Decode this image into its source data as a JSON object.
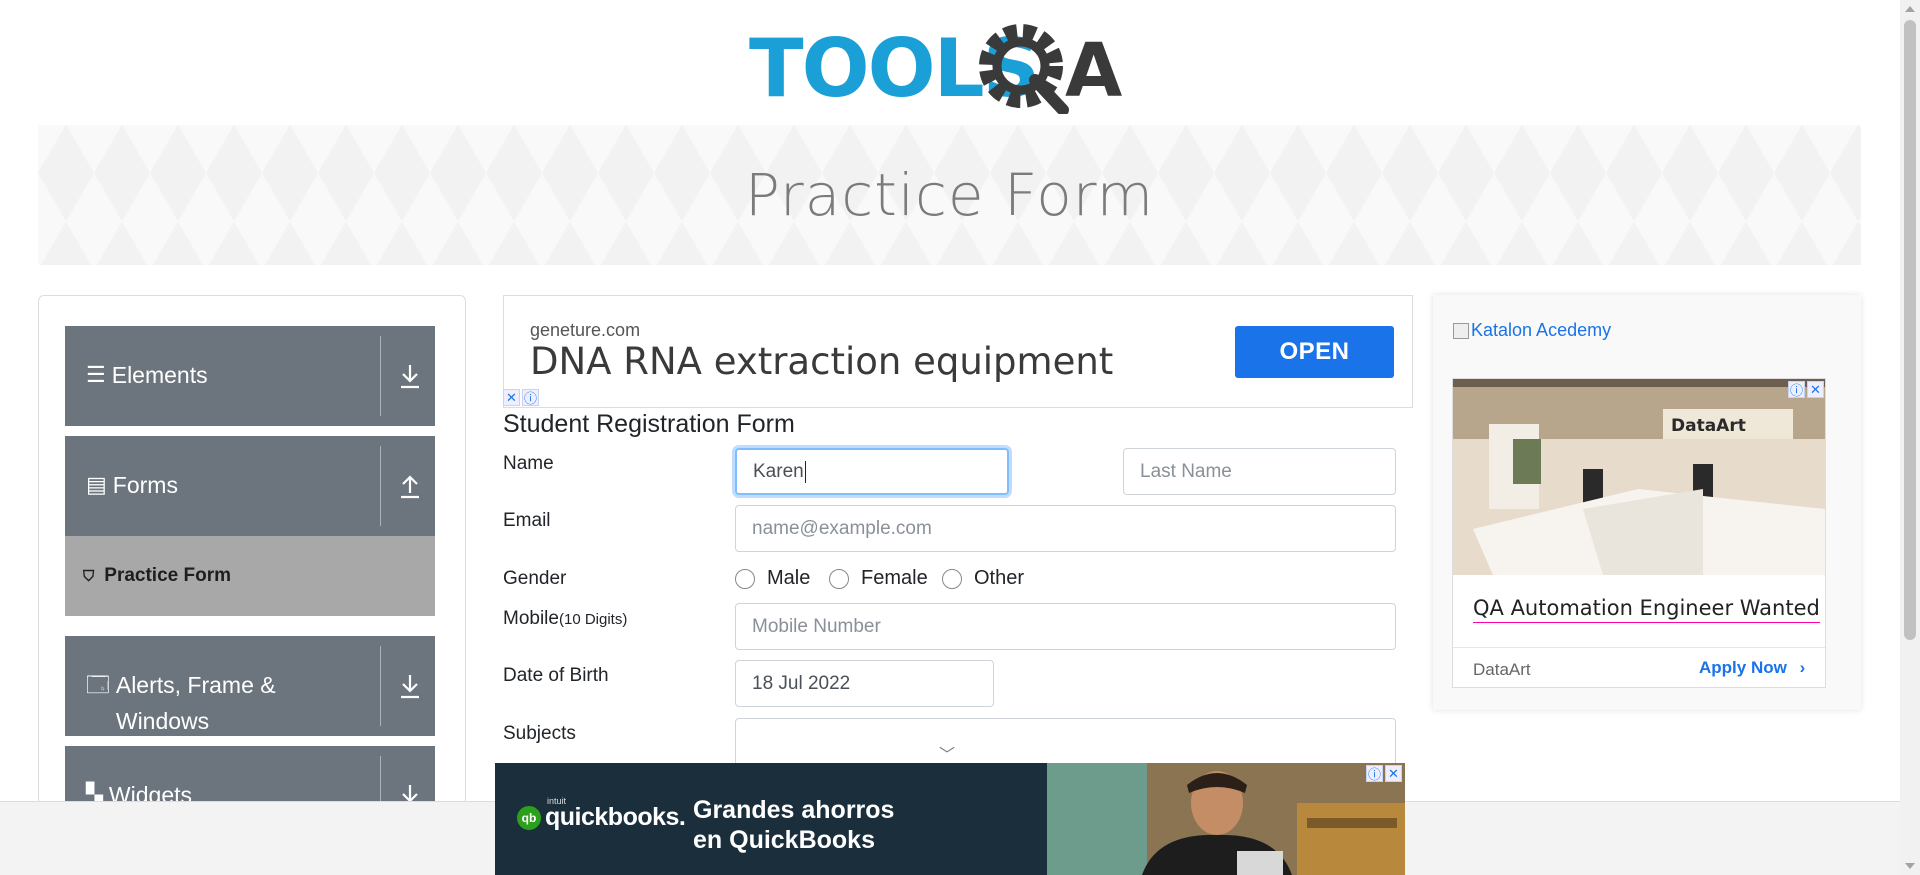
{
  "logo": {
    "text_left": "TOOLS",
    "text_right": "QA"
  },
  "banner": {
    "title": "Practice Form"
  },
  "sidebar": {
    "groups": [
      {
        "label": "Elements",
        "icon": "hamburger-icon",
        "toggle": "download-arrow-icon"
      },
      {
        "label": "Forms",
        "icon": "document-icon",
        "toggle": "upload-arrow-icon"
      },
      {
        "label": "Alerts, Frame &",
        "label2": "Windows",
        "icon": "window-icon",
        "toggle": "download-arrow-icon"
      },
      {
        "label": "Widgets",
        "icon": "widgets-icon",
        "toggle": "download-arrow-icon"
      }
    ],
    "active_item": {
      "label": "Practice Form",
      "icon": "html5-icon"
    }
  },
  "ad_top": {
    "domain": "geneture.com",
    "headline": "DNA RNA extraction equipment",
    "cta": "OPEN"
  },
  "form": {
    "title": "Student Registration Form",
    "name_label": "Name",
    "first_name_value": "Karen",
    "last_name_placeholder": "Last Name",
    "email_label": "Email",
    "email_placeholder": "name@example.com",
    "gender_label": "Gender",
    "gender_options": [
      "Male",
      "Female",
      "Other"
    ],
    "mobile_label": "Mobile",
    "mobile_hint": "(10 Digits)",
    "mobile_placeholder": "Mobile Number",
    "dob_label": "Date of Birth",
    "dob_value": "18 Jul 2022",
    "subjects_label": "Subjects"
  },
  "ad_right": {
    "broken_image_alt": "Katalon Acedemy",
    "photo_brand": "DataArt",
    "headline": "QA Automation Engineer Wanted",
    "advertiser": "DataArt",
    "cta": "Apply Now"
  },
  "ad_bottom": {
    "brand_small": "intuit",
    "brand": "quickbooks.",
    "badge": "qb",
    "tagline_1": "Grandes ahorros",
    "tagline_2": "en QuickBooks"
  },
  "colors": {
    "accent": "#1a73e8",
    "sidebar_group": "#6c757d",
    "sidebar_active": "#a8a8a8",
    "logo_blue": "#1a9fd6",
    "logo_dark": "#3a3a3a"
  }
}
